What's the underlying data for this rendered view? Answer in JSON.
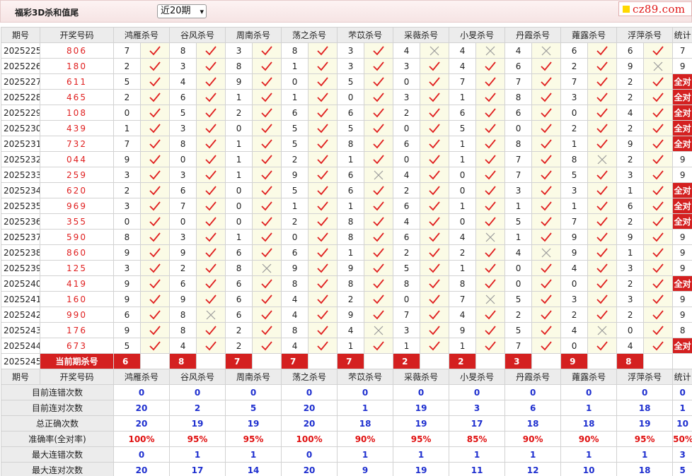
{
  "page_title": "福彩3D杀和值尾",
  "period_select": {
    "value": "近20期",
    "options": [
      "近20期"
    ]
  },
  "logo_text": "cz89.com",
  "columns": {
    "issue": "期号",
    "draw": "开奖号码",
    "experts": [
      "鸿雁杀号",
      "谷风杀号",
      "周南杀号",
      "荡之杀号",
      "芣苡杀号",
      "采薇杀号",
      "小旻杀号",
      "丹霞杀号",
      "蕹露杀号",
      "浮萍杀号"
    ],
    "stat": "统计"
  },
  "colors": {
    "accent_red": "#d42020",
    "stat_blue": "#1e2fcf",
    "mark_bg": "#fbfbe6"
  },
  "rows": [
    {
      "issue": "2025225",
      "draw": "806",
      "kills": [
        [
          "7",
          "y"
        ],
        [
          "8",
          "y"
        ],
        [
          "3",
          "y"
        ],
        [
          "8",
          "y"
        ],
        [
          "3",
          "y"
        ],
        [
          "4",
          "x"
        ],
        [
          "4",
          "x"
        ],
        [
          "4",
          "x"
        ],
        [
          "6",
          "y"
        ],
        [
          "6",
          "y"
        ]
      ],
      "stat": "7"
    },
    {
      "issue": "2025226",
      "draw": "180",
      "kills": [
        [
          "2",
          "y"
        ],
        [
          "3",
          "y"
        ],
        [
          "8",
          "y"
        ],
        [
          "1",
          "y"
        ],
        [
          "3",
          "y"
        ],
        [
          "3",
          "y"
        ],
        [
          "4",
          "y"
        ],
        [
          "6",
          "y"
        ],
        [
          "2",
          "y"
        ],
        [
          "9",
          "x"
        ]
      ],
      "stat": "9"
    },
    {
      "issue": "2025227",
      "draw": "611",
      "kills": [
        [
          "5",
          "y"
        ],
        [
          "4",
          "y"
        ],
        [
          "9",
          "y"
        ],
        [
          "0",
          "y"
        ],
        [
          "5",
          "y"
        ],
        [
          "0",
          "y"
        ],
        [
          "7",
          "y"
        ],
        [
          "7",
          "y"
        ],
        [
          "7",
          "y"
        ],
        [
          "2",
          "y"
        ]
      ],
      "stat": "全对"
    },
    {
      "issue": "2025228",
      "draw": "465",
      "kills": [
        [
          "2",
          "y"
        ],
        [
          "6",
          "y"
        ],
        [
          "1",
          "y"
        ],
        [
          "1",
          "y"
        ],
        [
          "0",
          "y"
        ],
        [
          "3",
          "y"
        ],
        [
          "1",
          "y"
        ],
        [
          "8",
          "y"
        ],
        [
          "3",
          "y"
        ],
        [
          "2",
          "y"
        ]
      ],
      "stat": "全对"
    },
    {
      "issue": "2025229",
      "draw": "108",
      "kills": [
        [
          "0",
          "y"
        ],
        [
          "5",
          "y"
        ],
        [
          "2",
          "y"
        ],
        [
          "6",
          "y"
        ],
        [
          "6",
          "y"
        ],
        [
          "2",
          "y"
        ],
        [
          "6",
          "y"
        ],
        [
          "6",
          "y"
        ],
        [
          "0",
          "y"
        ],
        [
          "4",
          "y"
        ]
      ],
      "stat": "全对"
    },
    {
      "issue": "2025230",
      "draw": "439",
      "kills": [
        [
          "1",
          "y"
        ],
        [
          "3",
          "y"
        ],
        [
          "0",
          "y"
        ],
        [
          "5",
          "y"
        ],
        [
          "5",
          "y"
        ],
        [
          "0",
          "y"
        ],
        [
          "5",
          "y"
        ],
        [
          "0",
          "y"
        ],
        [
          "2",
          "y"
        ],
        [
          "2",
          "y"
        ]
      ],
      "stat": "全对"
    },
    {
      "issue": "2025231",
      "draw": "732",
      "kills": [
        [
          "7",
          "y"
        ],
        [
          "8",
          "y"
        ],
        [
          "1",
          "y"
        ],
        [
          "5",
          "y"
        ],
        [
          "8",
          "y"
        ],
        [
          "6",
          "y"
        ],
        [
          "1",
          "y"
        ],
        [
          "8",
          "y"
        ],
        [
          "1",
          "y"
        ],
        [
          "9",
          "y"
        ]
      ],
      "stat": "全对"
    },
    {
      "issue": "2025232",
      "draw": "044",
      "kills": [
        [
          "9",
          "y"
        ],
        [
          "0",
          "y"
        ],
        [
          "1",
          "y"
        ],
        [
          "2",
          "y"
        ],
        [
          "1",
          "y"
        ],
        [
          "0",
          "y"
        ],
        [
          "1",
          "y"
        ],
        [
          "7",
          "y"
        ],
        [
          "8",
          "x"
        ],
        [
          "2",
          "y"
        ]
      ],
      "stat": "9"
    },
    {
      "issue": "2025233",
      "draw": "259",
      "kills": [
        [
          "3",
          "y"
        ],
        [
          "3",
          "y"
        ],
        [
          "1",
          "y"
        ],
        [
          "9",
          "y"
        ],
        [
          "6",
          "x"
        ],
        [
          "4",
          "y"
        ],
        [
          "0",
          "y"
        ],
        [
          "7",
          "y"
        ],
        [
          "5",
          "y"
        ],
        [
          "3",
          "y"
        ]
      ],
      "stat": "9"
    },
    {
      "issue": "2025234",
      "draw": "620",
      "kills": [
        [
          "2",
          "y"
        ],
        [
          "6",
          "y"
        ],
        [
          "0",
          "y"
        ],
        [
          "5",
          "y"
        ],
        [
          "6",
          "y"
        ],
        [
          "2",
          "y"
        ],
        [
          "0",
          "y"
        ],
        [
          "3",
          "y"
        ],
        [
          "3",
          "y"
        ],
        [
          "1",
          "y"
        ]
      ],
      "stat": "全对"
    },
    {
      "issue": "2025235",
      "draw": "969",
      "kills": [
        [
          "3",
          "y"
        ],
        [
          "7",
          "y"
        ],
        [
          "0",
          "y"
        ],
        [
          "1",
          "y"
        ],
        [
          "1",
          "y"
        ],
        [
          "6",
          "y"
        ],
        [
          "1",
          "y"
        ],
        [
          "1",
          "y"
        ],
        [
          "1",
          "y"
        ],
        [
          "6",
          "y"
        ]
      ],
      "stat": "全对"
    },
    {
      "issue": "2025236",
      "draw": "355",
      "kills": [
        [
          "0",
          "y"
        ],
        [
          "0",
          "y"
        ],
        [
          "0",
          "y"
        ],
        [
          "2",
          "y"
        ],
        [
          "8",
          "y"
        ],
        [
          "4",
          "y"
        ],
        [
          "0",
          "y"
        ],
        [
          "5",
          "y"
        ],
        [
          "7",
          "y"
        ],
        [
          "2",
          "y"
        ]
      ],
      "stat": "全对"
    },
    {
      "issue": "2025237",
      "draw": "590",
      "kills": [
        [
          "8",
          "y"
        ],
        [
          "3",
          "y"
        ],
        [
          "1",
          "y"
        ],
        [
          "0",
          "y"
        ],
        [
          "8",
          "y"
        ],
        [
          "6",
          "y"
        ],
        [
          "4",
          "x"
        ],
        [
          "1",
          "y"
        ],
        [
          "9",
          "y"
        ],
        [
          "9",
          "y"
        ]
      ],
      "stat": "9"
    },
    {
      "issue": "2025238",
      "draw": "860",
      "kills": [
        [
          "9",
          "y"
        ],
        [
          "9",
          "y"
        ],
        [
          "6",
          "y"
        ],
        [
          "6",
          "y"
        ],
        [
          "1",
          "y"
        ],
        [
          "2",
          "y"
        ],
        [
          "2",
          "y"
        ],
        [
          "4",
          "x"
        ],
        [
          "9",
          "y"
        ],
        [
          "1",
          "y"
        ]
      ],
      "stat": "9"
    },
    {
      "issue": "2025239",
      "draw": "125",
      "kills": [
        [
          "3",
          "y"
        ],
        [
          "2",
          "y"
        ],
        [
          "8",
          "x"
        ],
        [
          "9",
          "y"
        ],
        [
          "9",
          "y"
        ],
        [
          "5",
          "y"
        ],
        [
          "1",
          "y"
        ],
        [
          "0",
          "y"
        ],
        [
          "4",
          "y"
        ],
        [
          "3",
          "y"
        ]
      ],
      "stat": "9"
    },
    {
      "issue": "2025240",
      "draw": "419",
      "kills": [
        [
          "9",
          "y"
        ],
        [
          "6",
          "y"
        ],
        [
          "6",
          "y"
        ],
        [
          "8",
          "y"
        ],
        [
          "8",
          "y"
        ],
        [
          "8",
          "y"
        ],
        [
          "8",
          "y"
        ],
        [
          "0",
          "y"
        ],
        [
          "0",
          "y"
        ],
        [
          "2",
          "y"
        ]
      ],
      "stat": "全对"
    },
    {
      "issue": "2025241",
      "draw": "160",
      "kills": [
        [
          "9",
          "y"
        ],
        [
          "9",
          "y"
        ],
        [
          "6",
          "y"
        ],
        [
          "4",
          "y"
        ],
        [
          "2",
          "y"
        ],
        [
          "0",
          "y"
        ],
        [
          "7",
          "x"
        ],
        [
          "5",
          "y"
        ],
        [
          "3",
          "y"
        ],
        [
          "3",
          "y"
        ]
      ],
      "stat": "9"
    },
    {
      "issue": "2025242",
      "draw": "990",
      "kills": [
        [
          "6",
          "y"
        ],
        [
          "8",
          "x"
        ],
        [
          "6",
          "y"
        ],
        [
          "4",
          "y"
        ],
        [
          "9",
          "y"
        ],
        [
          "7",
          "y"
        ],
        [
          "4",
          "y"
        ],
        [
          "2",
          "y"
        ],
        [
          "2",
          "y"
        ],
        [
          "2",
          "y"
        ]
      ],
      "stat": "9"
    },
    {
      "issue": "2025243",
      "draw": "176",
      "kills": [
        [
          "9",
          "y"
        ],
        [
          "8",
          "y"
        ],
        [
          "2",
          "y"
        ],
        [
          "8",
          "y"
        ],
        [
          "4",
          "x"
        ],
        [
          "3",
          "y"
        ],
        [
          "9",
          "y"
        ],
        [
          "5",
          "y"
        ],
        [
          "4",
          "x"
        ],
        [
          "0",
          "y"
        ]
      ],
      "stat": "8"
    },
    {
      "issue": "2025244",
      "draw": "673",
      "kills": [
        [
          "5",
          "y"
        ],
        [
          "4",
          "y"
        ],
        [
          "2",
          "y"
        ],
        [
          "4",
          "y"
        ],
        [
          "1",
          "y"
        ],
        [
          "1",
          "y"
        ],
        [
          "1",
          "y"
        ],
        [
          "7",
          "y"
        ],
        [
          "0",
          "y"
        ],
        [
          "4",
          "y"
        ]
      ],
      "stat": "全对"
    }
  ],
  "current": {
    "issue": "2025245",
    "label": "当前期杀号",
    "values": [
      "6",
      "8",
      "7",
      "7",
      "7",
      "2",
      "2",
      "3",
      "9",
      "8"
    ]
  },
  "stats": [
    {
      "label": "目前连错次数",
      "values": [
        "0",
        "0",
        "0",
        "0",
        "0",
        "0",
        "0",
        "0",
        "0",
        "0",
        "0"
      ]
    },
    {
      "label": "目前连对次数",
      "values": [
        "20",
        "2",
        "5",
        "20",
        "1",
        "19",
        "3",
        "6",
        "1",
        "18",
        "1"
      ]
    },
    {
      "label": "总正确次数",
      "values": [
        "20",
        "19",
        "19",
        "20",
        "18",
        "19",
        "17",
        "18",
        "18",
        "19",
        "10"
      ]
    },
    {
      "label": "准确率(全对率)",
      "values": [
        "100%",
        "95%",
        "95%",
        "100%",
        "90%",
        "95%",
        "85%",
        "90%",
        "90%",
        "95%",
        "50%"
      ],
      "rate": true
    },
    {
      "label": "最大连错次数",
      "values": [
        "0",
        "1",
        "1",
        "0",
        "1",
        "1",
        "1",
        "1",
        "1",
        "1",
        "3"
      ]
    },
    {
      "label": "最大连对次数",
      "values": [
        "20",
        "17",
        "14",
        "20",
        "9",
        "19",
        "11",
        "12",
        "10",
        "18",
        "5"
      ]
    }
  ]
}
